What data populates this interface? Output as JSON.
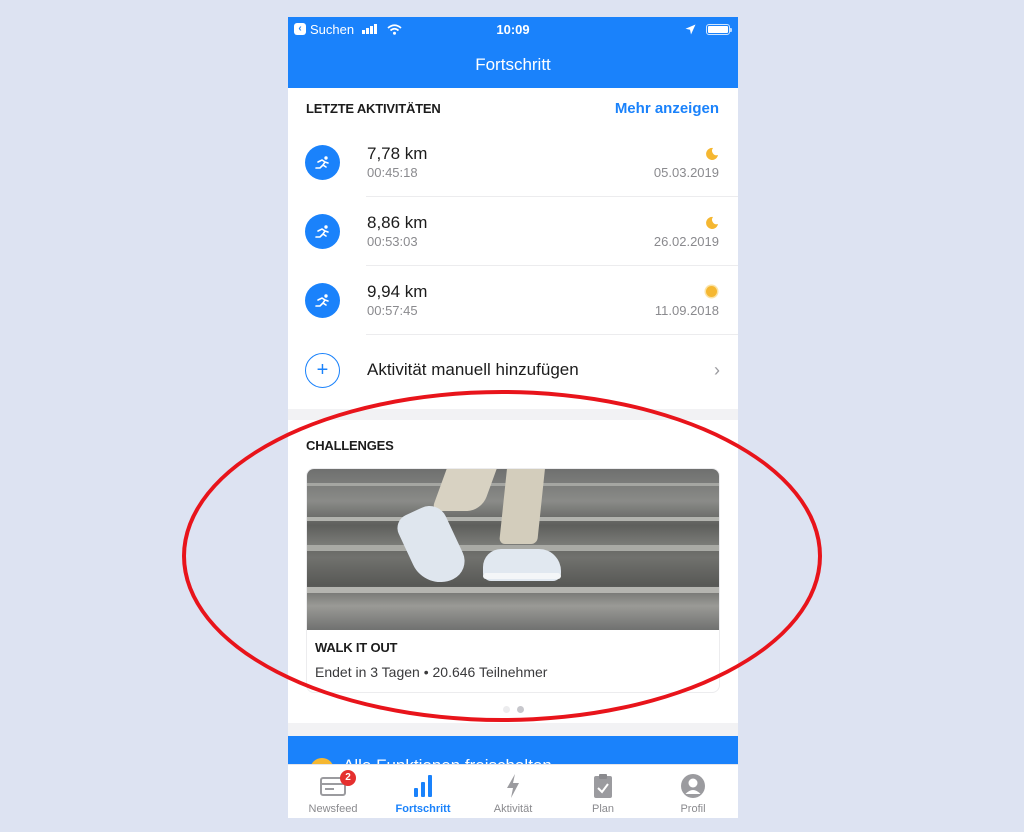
{
  "statusbar": {
    "back_label": "Suchen",
    "time": "10:09",
    "battery_level": 1.0
  },
  "header": {
    "title": "Fortschritt"
  },
  "activities": {
    "title": "LETZTE AKTIVITÄTEN",
    "more_label": "Mehr anzeigen",
    "items": [
      {
        "distance": "7,78 km",
        "duration": "00:45:18",
        "date": "05.03.2019",
        "weather": "moon"
      },
      {
        "distance": "8,86 km",
        "duration": "00:53:03",
        "date": "26.02.2019",
        "weather": "moon"
      },
      {
        "distance": "9,94 km",
        "duration": "00:57:45",
        "date": "11.09.2018",
        "weather": "sun"
      }
    ],
    "add_label": "Aktivität manuell hinzufügen"
  },
  "challenges": {
    "title": "CHALLENGES",
    "card": {
      "title": "WALK IT OUT",
      "subtitle": "Endet in 3 Tagen • 20.646 Teilnehmer",
      "image_alt": "runner-shoes-on-stairs"
    },
    "pager": {
      "count": 2,
      "active_index": 1
    }
  },
  "premium_banner": {
    "label": "Alle Funktionen freischalten"
  },
  "tabbar": {
    "tabs": [
      {
        "label": "Newsfeed",
        "icon": "newsfeed-icon",
        "badge": "2"
      },
      {
        "label": "Fortschritt",
        "icon": "progress-bars-icon",
        "active": true
      },
      {
        "label": "Aktivität",
        "icon": "lightning-icon"
      },
      {
        "label": "Plan",
        "icon": "clipboard-check-icon"
      },
      {
        "label": "Profil",
        "icon": "profile-icon"
      }
    ]
  },
  "colors": {
    "accent": "#1a82fb",
    "annotation": "#e8141b",
    "badge": "#e5302f",
    "weather": "#f5b731"
  }
}
